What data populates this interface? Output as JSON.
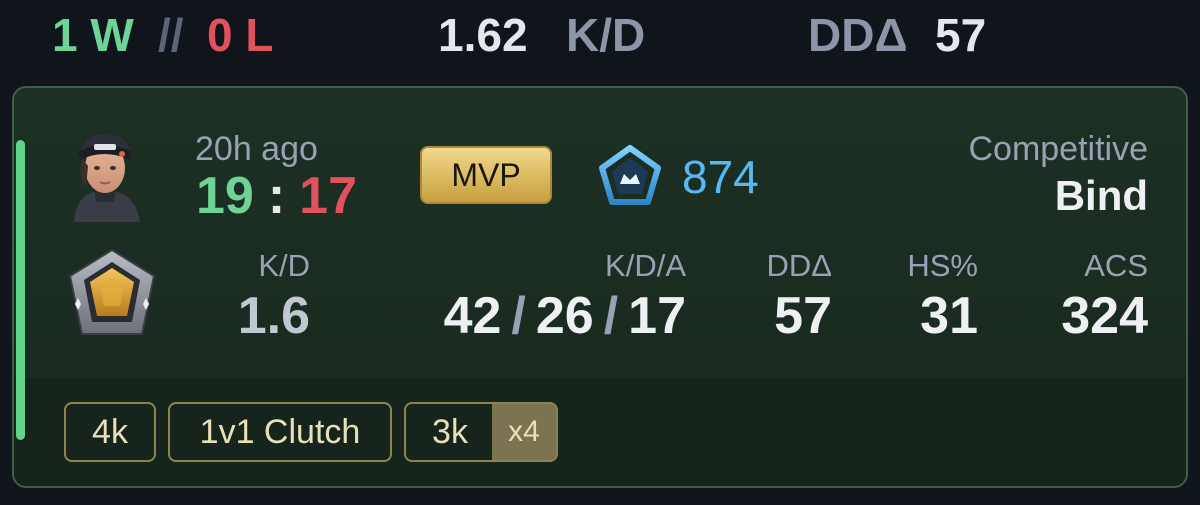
{
  "summary": {
    "wins": "1 W",
    "separator": "//",
    "losses": "0 L",
    "kd_value": "1.62",
    "kd_label": "K/D",
    "dd_label": "DDΔ",
    "dd_value": "57"
  },
  "match": {
    "time_ago": "20h ago",
    "score_team": "19",
    "score_separator": ":",
    "score_enemy": "17",
    "mvp_label": "MVP",
    "rr_value": "874",
    "mode": "Competitive",
    "map": "Bind",
    "stats": {
      "kd_label": "K/D",
      "kd_value": "1.6",
      "kda_label": "K/D/A",
      "kills": "42",
      "deaths": "26",
      "assists": "17",
      "kda_separator": "/",
      "dd_label": "DDΔ",
      "dd_value": "57",
      "hs_label": "HS%",
      "hs_value": "31",
      "acs_label": "ACS",
      "acs_value": "324"
    },
    "badges": [
      {
        "label": "4k"
      },
      {
        "label": "1v1 Clutch"
      },
      {
        "label": "3k",
        "multiplier": "x4"
      }
    ]
  },
  "icons": {
    "agent": "agent-portrait-icon",
    "rr": "leaderboard-rank-icon",
    "rank": "gold-rank-icon"
  },
  "colors": {
    "win": "#6fd397",
    "loss": "#e0525e",
    "rr": "#58b9f2",
    "mvp_gold": "#d8b65b",
    "card_bg": "#1d3024"
  }
}
